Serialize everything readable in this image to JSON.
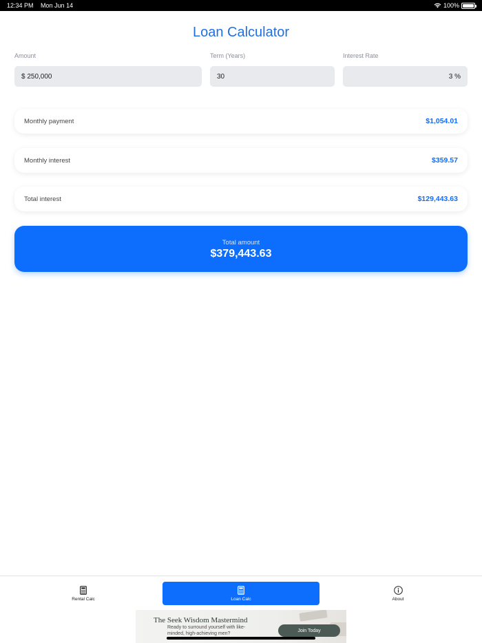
{
  "status": {
    "time": "12:34 PM",
    "date": "Mon Jun 14",
    "battery": "100%"
  },
  "title": "Loan Calculator",
  "inputs": {
    "amount": {
      "label": "Amount",
      "value": "$ 250,000"
    },
    "term": {
      "label": "Term (Years)",
      "value": "30"
    },
    "rate": {
      "label": "Interest Rate",
      "value": "3 %"
    }
  },
  "results": [
    {
      "label": "Monthly payment",
      "value": "$1,054.01"
    },
    {
      "label": "Monthly interest",
      "value": "$359.57"
    },
    {
      "label": "Total interest",
      "value": "$129,443.63"
    }
  ],
  "total": {
    "label": "Total amount",
    "value": "$379,443.63"
  },
  "tabs": [
    {
      "label": "Rental Calc",
      "icon": "calculator-icon"
    },
    {
      "label": "Loan Calc",
      "icon": "calculator-icon",
      "active": true
    },
    {
      "label": "About",
      "icon": "info-icon"
    }
  ],
  "ad": {
    "title": "The Seek Wisdom Mastermind",
    "subtitle": "Ready to surround yourself with like-minded, high-achieving men?",
    "button": "Join Today"
  },
  "colors": {
    "accent": "#0d6efd",
    "field_bg": "#e8eaed"
  }
}
